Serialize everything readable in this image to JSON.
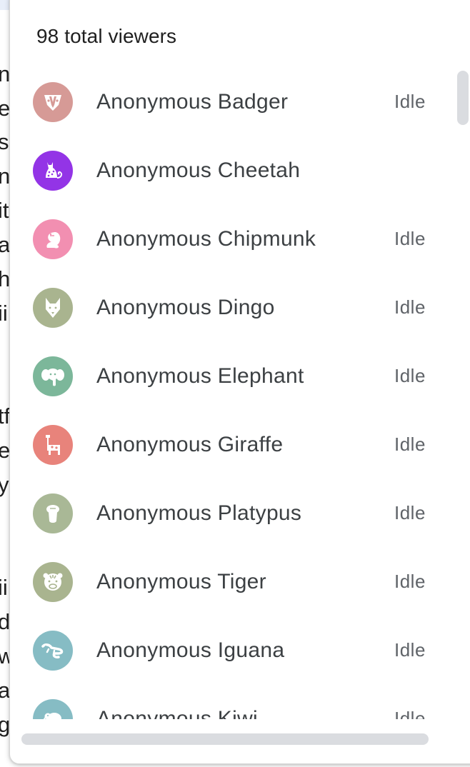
{
  "background_doc": {
    "edge_chars": [
      "n",
      "es",
      "s",
      "na",
      "it",
      "a",
      "h",
      "ii",
      "tf",
      "e",
      "y,",
      "ii",
      "d",
      "w",
      "ai",
      "g"
    ]
  },
  "panel": {
    "title": "98 total viewers"
  },
  "viewers": [
    {
      "name": "Anonymous Badger",
      "status": "Idle",
      "icon": "badger-icon",
      "color": "#d69a96"
    },
    {
      "name": "Anonymous Cheetah",
      "status": "",
      "icon": "cheetah-icon",
      "color": "#9334e6"
    },
    {
      "name": "Anonymous Chipmunk",
      "status": "Idle",
      "icon": "chipmunk-icon",
      "color": "#f28fb1"
    },
    {
      "name": "Anonymous Dingo",
      "status": "Idle",
      "icon": "dingo-icon",
      "color": "#a9b48f"
    },
    {
      "name": "Anonymous Elephant",
      "status": "Idle",
      "icon": "elephant-icon",
      "color": "#7cb79a"
    },
    {
      "name": "Anonymous Giraffe",
      "status": "Idle",
      "icon": "giraffe-icon",
      "color": "#e8837b"
    },
    {
      "name": "Anonymous Platypus",
      "status": "Idle",
      "icon": "platypus-icon",
      "color": "#a9b896"
    },
    {
      "name": "Anonymous Tiger",
      "status": "Idle",
      "icon": "tiger-icon",
      "color": "#a9b48f"
    },
    {
      "name": "Anonymous Iguana",
      "status": "Idle",
      "icon": "iguana-icon",
      "color": "#86bcc4"
    },
    {
      "name": "Anonymous Kiwi",
      "status": "Idle",
      "icon": "kiwi-icon",
      "color": "#86bcc4"
    }
  ]
}
